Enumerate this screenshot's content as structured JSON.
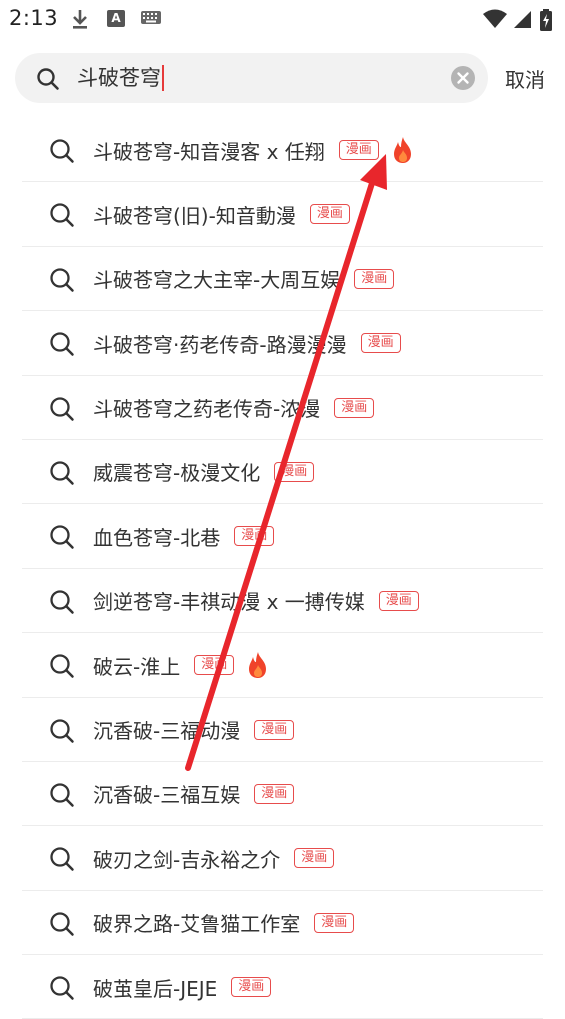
{
  "status_bar": {
    "time": "2:13"
  },
  "search": {
    "query": "斗破苍穹"
  },
  "actions": {
    "cancel_label": "取消"
  },
  "suggestions": [
    {
      "text": "斗破苍穹-知音漫客 x 任翔",
      "tag": "漫画",
      "hot": true
    },
    {
      "text": "斗破苍穹(旧)-知音動漫",
      "tag": "漫画",
      "hot": false
    },
    {
      "text": "斗破苍穹之大主宰-大周互娱",
      "tag": "漫画",
      "hot": false
    },
    {
      "text": "斗破苍穹·药老传奇-路漫漫漫",
      "tag": "漫画",
      "hot": false
    },
    {
      "text": "斗破苍穹之药老传奇-浓漫",
      "tag": "漫画",
      "hot": false
    },
    {
      "text": "威震苍穹-极漫文化",
      "tag": "漫画",
      "hot": false
    },
    {
      "text": "血色苍穹-北巷",
      "tag": "漫画",
      "hot": false
    },
    {
      "text": "剑逆苍穹-丰祺动漫 x 一搏传媒",
      "tag": "漫画",
      "hot": false
    },
    {
      "text": "破云-淮上",
      "tag": "漫画",
      "hot": true
    },
    {
      "text": "沉香破-三福动漫",
      "tag": "漫画",
      "hot": false
    },
    {
      "text": "沉香破-三福互娱",
      "tag": "漫画",
      "hot": false
    },
    {
      "text": "破刃之剑-吉永裕之介",
      "tag": "漫画",
      "hot": false
    },
    {
      "text": "破界之路-艾鲁猫工作室",
      "tag": "漫画",
      "hot": false
    },
    {
      "text": "破茧皇后-JEJE",
      "tag": "漫画",
      "hot": false
    }
  ],
  "colors": {
    "accent": "#e74c4c",
    "annotation": "#e8262c"
  },
  "icons": {
    "search": "search-icon",
    "clear": "clear-icon",
    "hot": "fire-icon"
  }
}
